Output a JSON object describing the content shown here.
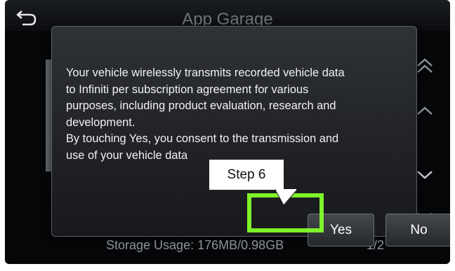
{
  "screen": {
    "title": "App Garage",
    "storage_text": "Storage Usage: 176MB/0.98GB",
    "page_indicator": "1/2",
    "icons": {
      "back": "back-arrow-icon",
      "scroll_top": "double-chevron-up-icon",
      "scroll_up": "chevron-up-icon",
      "scroll_down": "chevron-down-icon",
      "scroll_bottom": "double-chevron-down-icon"
    }
  },
  "dialog": {
    "message": "Your vehicle wirelessly transmits recorded vehicle data\nto Infiniti per subscription agreement for various\npurposes, including product evaluation, research and\ndevelopment.\nBy touching Yes, you consent to the transmission and\nuse of your vehicle data",
    "yes_label": "Yes",
    "no_label": "No"
  },
  "annotation": {
    "step_label": "Step 6",
    "highlight_color": "#7ff32a"
  }
}
